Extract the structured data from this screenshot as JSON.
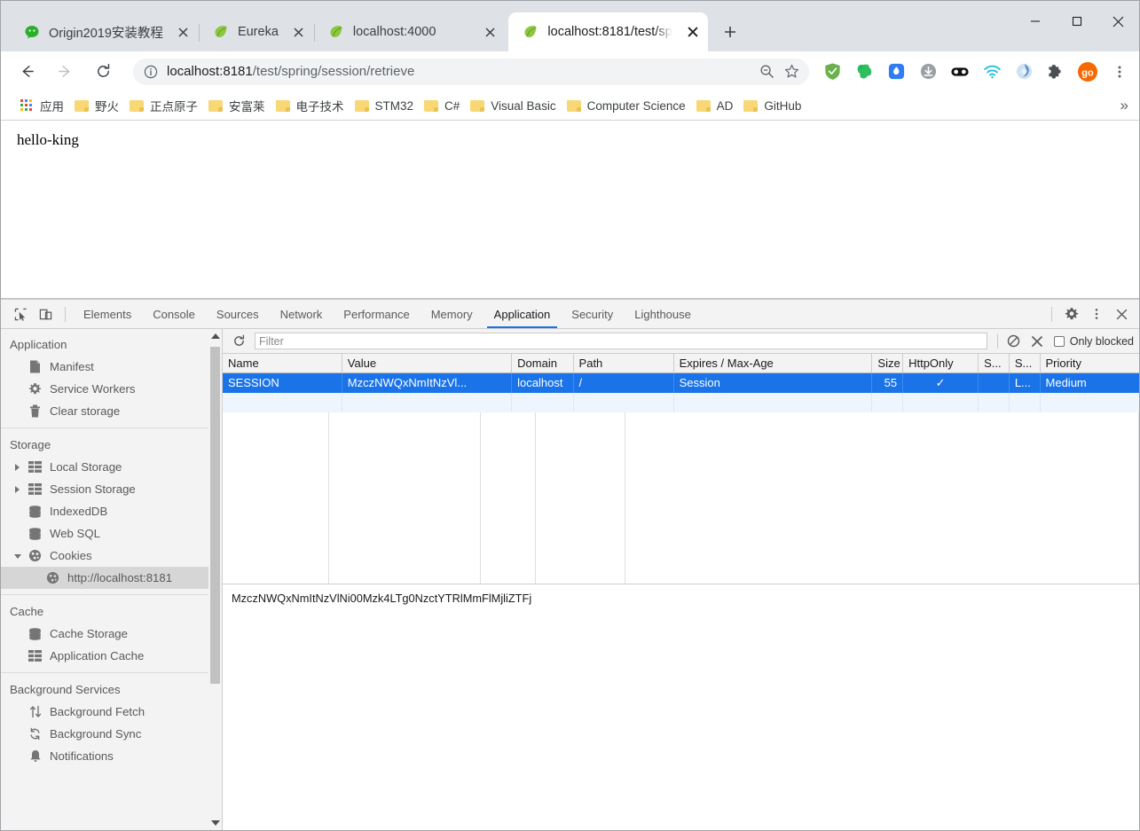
{
  "window": {
    "minimize_label": "Minimize",
    "maximize_label": "Maximize",
    "close_label": "Close"
  },
  "tabs": [
    {
      "title": "Origin2019安装教程",
      "favicon": "wechat-icon",
      "active": false
    },
    {
      "title": "Eureka",
      "favicon": "spring-leaf-icon",
      "active": false
    },
    {
      "title": "localhost:4000",
      "favicon": "spring-leaf-icon",
      "active": false
    },
    {
      "title": "localhost:8181/test/sp",
      "favicon": "spring-leaf-icon",
      "active": true
    }
  ],
  "newtab_label": "+",
  "toolbar": {
    "back_label": "Back",
    "forward_label": "Forward",
    "reload_label": "Reload",
    "url_host": "localhost:8181",
    "url_path": "/test/spring/session/retrieve",
    "zoom_label": "Zoom out",
    "bookmark_label": "Bookmark this page",
    "profile_label": "go",
    "menu_label": "Customize and control Google Chrome"
  },
  "extensions": [
    {
      "name": "adguard-shield-icon",
      "color": "#6ab04c"
    },
    {
      "name": "evernote-elephant-icon",
      "color": "#2dbe60"
    },
    {
      "name": "droplet-icon",
      "color": "#2f7df0"
    },
    {
      "name": "download-icon",
      "color": "#9aa0a6"
    },
    {
      "name": "glasses-icon",
      "color": "#111111"
    },
    {
      "name": "wifi-icon",
      "color": "#22c1e0"
    },
    {
      "name": "circle-swirl-icon",
      "color": "#9ec4e8"
    },
    {
      "name": "puzzle-icon",
      "color": "#4b4f55"
    },
    {
      "name": "profile-avatar",
      "color": "#f96800"
    }
  ],
  "bookmarks": {
    "items": [
      {
        "label": "应用",
        "icon": "apps-grid-icon"
      },
      {
        "label": "野火",
        "icon": "folder-icon"
      },
      {
        "label": "正点原子",
        "icon": "folder-icon"
      },
      {
        "label": "安富莱",
        "icon": "folder-icon"
      },
      {
        "label": "电子技术",
        "icon": "folder-icon"
      },
      {
        "label": "STM32",
        "icon": "folder-icon"
      },
      {
        "label": "C#",
        "icon": "folder-icon"
      },
      {
        "label": "Visual Basic",
        "icon": "folder-icon"
      },
      {
        "label": "Computer Science",
        "icon": "folder-icon"
      },
      {
        "label": "AD",
        "icon": "folder-icon"
      },
      {
        "label": "GitHub",
        "icon": "folder-icon"
      }
    ],
    "overflow_label": "»"
  },
  "page": {
    "body_text": "hello-king"
  },
  "devtools": {
    "inspect_label": "Inspect element",
    "device_toolbar_label": "Toggle device toolbar",
    "tabs": [
      {
        "label": "Elements",
        "active": false
      },
      {
        "label": "Console",
        "active": false
      },
      {
        "label": "Sources",
        "active": false
      },
      {
        "label": "Network",
        "active": false
      },
      {
        "label": "Performance",
        "active": false
      },
      {
        "label": "Memory",
        "active": false
      },
      {
        "label": "Application",
        "active": true
      },
      {
        "label": "Security",
        "active": false
      },
      {
        "label": "Lighthouse",
        "active": false
      }
    ],
    "settings_label": "Settings",
    "more_label": "More options",
    "close_label": "Close DevTools",
    "accent_color": "#1a73e8",
    "sidebar": {
      "groups": [
        {
          "title": "Application",
          "items": [
            {
              "label": "Manifest",
              "icon": "document-icon",
              "selected": false,
              "expander": "none"
            },
            {
              "label": "Service Workers",
              "icon": "gear-icon",
              "selected": false,
              "expander": "none"
            },
            {
              "label": "Clear storage",
              "icon": "trash-icon",
              "selected": false,
              "expander": "none"
            }
          ]
        },
        {
          "title": "Storage",
          "items": [
            {
              "label": "Local Storage",
              "icon": "table-icon",
              "selected": false,
              "expander": "collapsed"
            },
            {
              "label": "Session Storage",
              "icon": "table-icon",
              "selected": false,
              "expander": "collapsed"
            },
            {
              "label": "IndexedDB",
              "icon": "database-icon",
              "selected": false,
              "expander": "none"
            },
            {
              "label": "Web SQL",
              "icon": "database-icon",
              "selected": false,
              "expander": "none"
            },
            {
              "label": "Cookies",
              "icon": "cookie-icon",
              "selected": false,
              "expander": "expanded"
            },
            {
              "label": "http://localhost:8181",
              "icon": "cookie-icon",
              "selected": true,
              "expander": "none",
              "indent": 2
            }
          ]
        },
        {
          "title": "Cache",
          "items": [
            {
              "label": "Cache Storage",
              "icon": "database-icon",
              "selected": false,
              "expander": "none"
            },
            {
              "label": "Application Cache",
              "icon": "table-icon",
              "selected": false,
              "expander": "none"
            }
          ]
        },
        {
          "title": "Background Services",
          "items": [
            {
              "label": "Background Fetch",
              "icon": "arrows-updown-icon",
              "selected": false,
              "expander": "none"
            },
            {
              "label": "Background Sync",
              "icon": "sync-icon",
              "selected": false,
              "expander": "none"
            },
            {
              "label": "Notifications",
              "icon": "bell-icon",
              "selected": false,
              "expander": "none"
            }
          ]
        }
      ]
    },
    "cookies_toolbar": {
      "refresh_label": "Refresh",
      "filter_placeholder": "Filter",
      "filter_value": "",
      "clear_all_label": "Clear all cookies",
      "delete_label": "Delete selected cookie",
      "only_blocked_label": "Only blocked",
      "only_blocked_checked": false
    },
    "cookies_table": {
      "columns": [
        "Name",
        "Value",
        "Domain",
        "Path",
        "Expires / Max-Age",
        "Size",
        "HttpOnly",
        "S...",
        "S...",
        "Priority"
      ],
      "rows": [
        {
          "name": "SESSION",
          "value": "MzczNWQxNmItNzVl...",
          "domain": "localhost",
          "path": "/",
          "expires": "Session",
          "size": "55",
          "httponly": "✓",
          "secure": "",
          "samesite": "L...",
          "priority": "Medium",
          "selected": true
        }
      ]
    },
    "cookie_preview": {
      "value": "MzczNWQxNmItNzVlNi00Mzk4LTg0NzctYTRlMmFlMjliZTFj"
    }
  }
}
